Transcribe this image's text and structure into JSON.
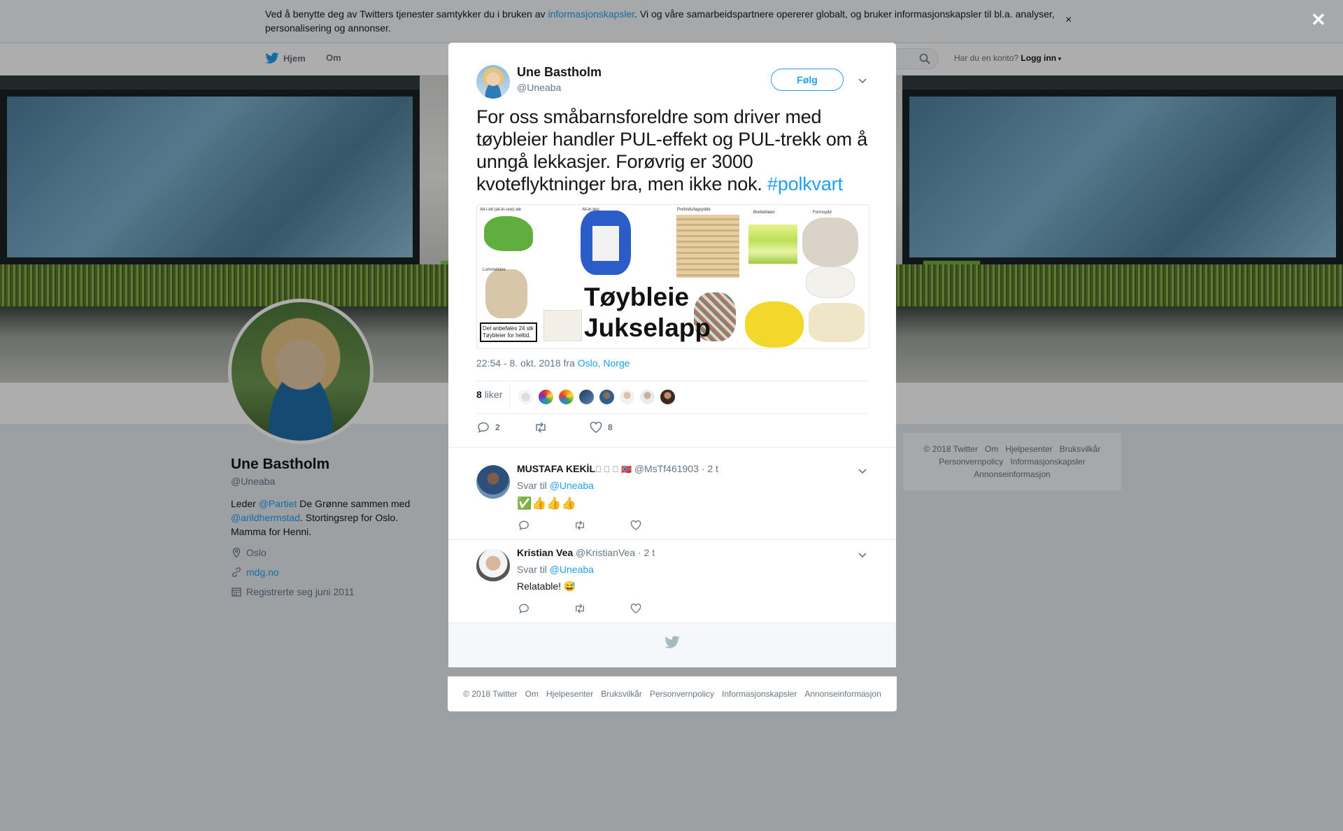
{
  "cookie": {
    "text_before": "Ved å benytte deg av Twitters tjenester samtykker du i bruken av ",
    "link": "informasjonskapsler",
    "text_after": ". Vi og våre samarbeidspartnere opererer globalt, og bruker informasjonskapsler til bl.a. analyser, personalisering og annonser.",
    "close": "×"
  },
  "nav": {
    "home": "Hjem",
    "about": "Om",
    "account_prompt": "Har du en konto?",
    "login": "Logg inn"
  },
  "profile": {
    "name": "Une Bastholm",
    "handle": "@Uneaba",
    "bio_1": "Leder ",
    "bio_link1": "@Partiet",
    "bio_2": " De Grønne sammen med ",
    "bio_link2": "@arildhermstad",
    "bio_3": ". Stortingsrep for Oslo. Mamma for Henni.",
    "location": "Oslo",
    "website": "mdg.no",
    "joined": "Registrerte seg juni 2011"
  },
  "side_footer": {
    "items": [
      "© 2018 Twitter",
      "Om",
      "Hjelpesenter",
      "Bruksvilkår",
      "Personvernpolicy",
      "Informasjonskapsler",
      "Annonseinformasjon"
    ]
  },
  "overlay": {
    "close": "✕"
  },
  "tweet": {
    "author_name": "Une Bastholm",
    "author_handle": "@Uneaba",
    "follow": "Følg",
    "text": "For oss småbarnsforeldre som driver med tøybleier handler PUL-effekt og PUL-trekk om å unngå lekkasjer. Forøvrig er 3000 kvoteflyktninger bra, men ikke nok. ",
    "hashtag": "#polkvart",
    "media_title_1": "Tøybleie",
    "media_title_2": "Jukselapp",
    "media_note": "Det anbefales 24 stk Tøybleier for heltid.",
    "media_labels": [
      "Alt-i-ett (all-in-one) ale",
      "All-in-two",
      "Prefolds/lagsydde",
      "Brettebleier",
      "Formsydd",
      "Lommebleie"
    ],
    "time": "22:54 - 8. okt. 2018 fra ",
    "place": "Oslo, Norge",
    "likes_count": "8",
    "likes_label": "liker",
    "reply_count": "2",
    "like_count": "8"
  },
  "replies": [
    {
      "name": "MUSTAFA KEKİL",
      "flags": "\u0000 \u0000 \u0000 🇳🇴",
      "handle": "@MsTf461903",
      "time": "· 2 t",
      "reply_to_label": "Svar til ",
      "reply_to": "@Uneaba",
      "text": "✅👍👍👍"
    },
    {
      "name": "Kristian Vea",
      "flags": "",
      "handle": "@KristianVea",
      "time": "· 2 t",
      "reply_to_label": "Svar til ",
      "reply_to": "@Uneaba",
      "text": "Relatable! 😅"
    }
  ],
  "bottom_footer": {
    "items": [
      "© 2018 Twitter",
      "Om",
      "Hjelpesenter",
      "Bruksvilkår",
      "Personvernpolicy",
      "Informasjonskapsler",
      "Annonseinformasjon"
    ]
  },
  "colors": {
    "accent": "#1da1f2",
    "page_bg": "#e6ecf0",
    "modal_bg": "#ffffff"
  }
}
